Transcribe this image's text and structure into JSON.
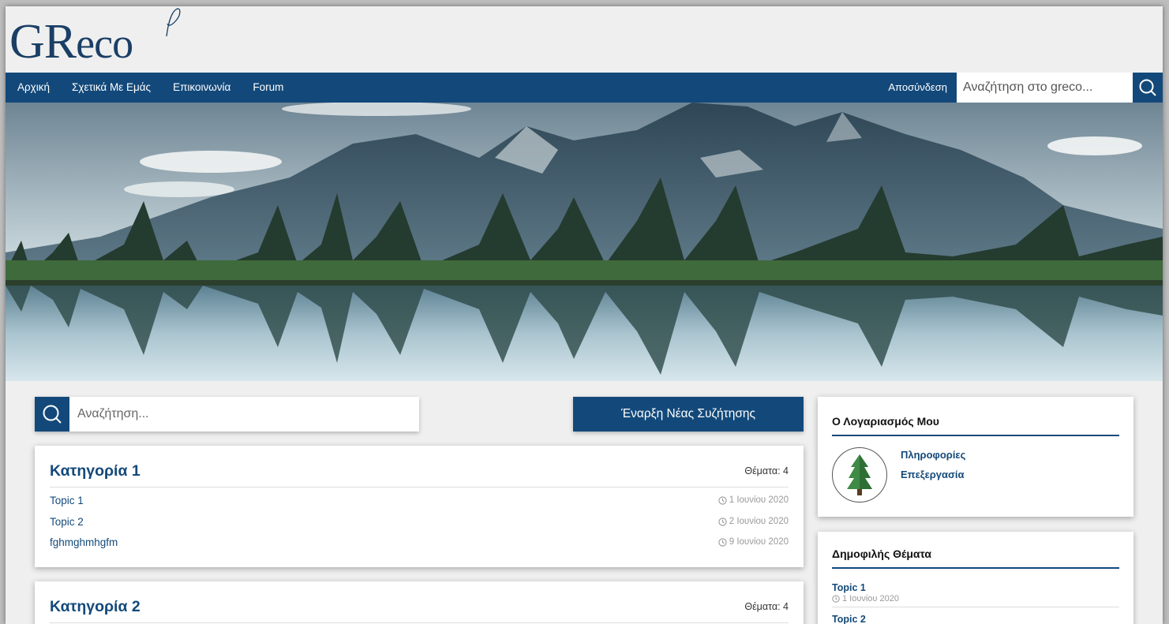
{
  "logo": {
    "text_big": "GR",
    "text_small": "eco"
  },
  "nav": {
    "items": [
      "Αρχική",
      "Σχετικά Με Εμάς",
      "Επικοινωνία",
      "Forum"
    ],
    "logout": "Αποσύνδεση",
    "search_placeholder": "Αναζήτηση στο greco..."
  },
  "main": {
    "search_placeholder": "Αναζήτηση...",
    "new_topic": "Έναρξη Νέας Συζήτησης",
    "categories": [
      {
        "title": "Κατηγορία 1",
        "count": "Θέματα: 4",
        "topics": [
          {
            "title": "Topic 1",
            "date": "1 Ιουνίου 2020"
          },
          {
            "title": "Topic 2",
            "date": "2 Ιουνίου 2020"
          },
          {
            "title": "fghmghmhgfm",
            "date": "9 Ιουνίου 2020"
          }
        ]
      },
      {
        "title": "Κατηγορία 2",
        "count": "Θέματα: 4",
        "topics": []
      }
    ]
  },
  "sidebar": {
    "account": {
      "title": "Ο Λογαριασμός Μου",
      "info_link": "Πληροφορίες",
      "edit_link": "Επεξεργασία"
    },
    "popular": {
      "title": "Δημοφιλής Θέματα",
      "topics": [
        {
          "title": "Topic 1",
          "date": "1 Ιουνίου 2020"
        },
        {
          "title": "Topic 2",
          "date": ""
        }
      ]
    }
  },
  "colors": {
    "primary": "#13497a",
    "background": "#efefef"
  }
}
